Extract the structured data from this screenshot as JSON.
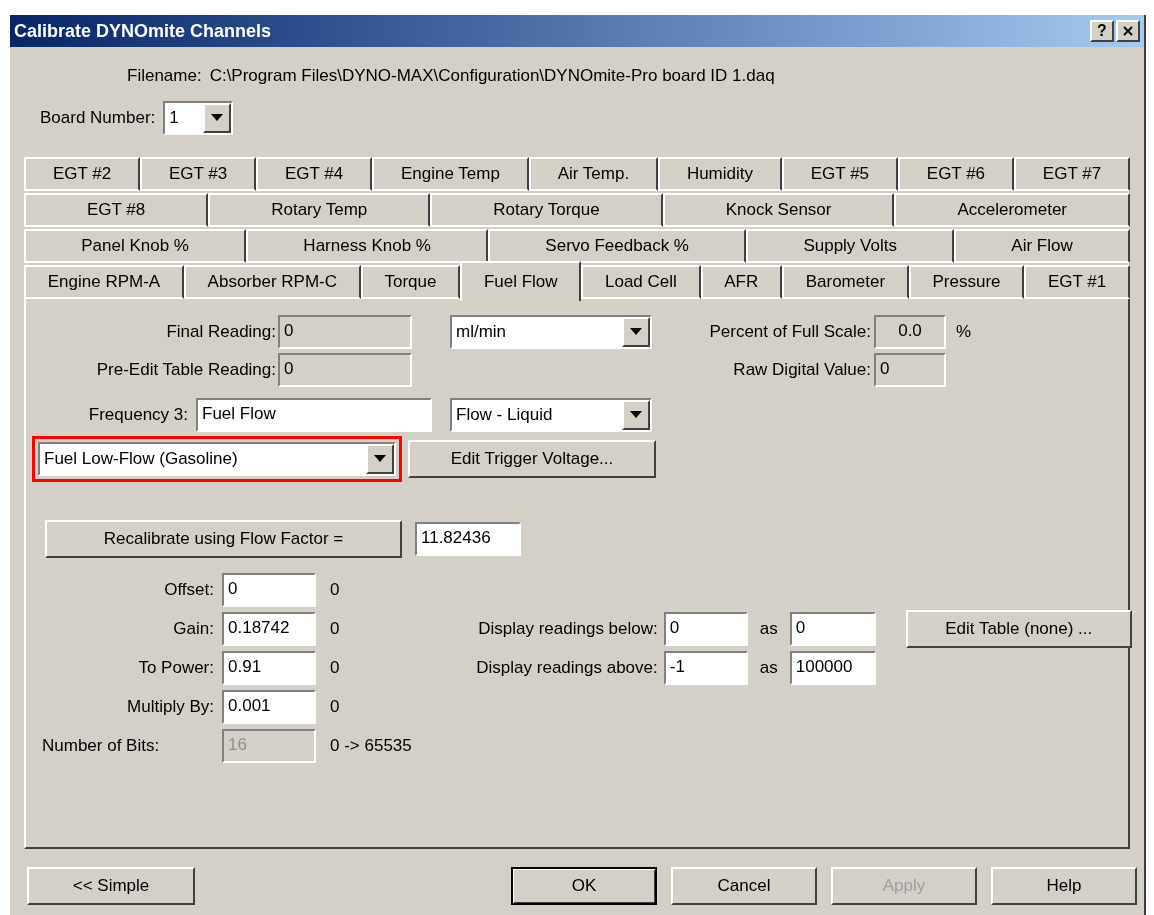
{
  "window": {
    "title": "Calibrate DYNOmite Channels",
    "help_button": "?"
  },
  "filename": {
    "label": "Filename:",
    "value": "C:\\Program Files\\DYNO-MAX\\Configuration\\DYNOmite-Pro board ID 1.daq"
  },
  "board_number": {
    "label": "Board Number:",
    "value": "1"
  },
  "tab_rows": [
    [
      {
        "label": "EGT #2",
        "selected": false
      },
      {
        "label": "EGT #3",
        "selected": false
      },
      {
        "label": "EGT #4",
        "selected": false
      },
      {
        "label": "Engine Temp",
        "selected": false
      },
      {
        "label": "Air Temp.",
        "selected": false
      },
      {
        "label": "Humidity",
        "selected": false
      },
      {
        "label": "EGT #5",
        "selected": false
      },
      {
        "label": "EGT #6",
        "selected": false
      },
      {
        "label": "EGT #7",
        "selected": false
      }
    ],
    [
      {
        "label": "EGT #8",
        "selected": false
      },
      {
        "label": "Rotary Temp",
        "selected": false
      },
      {
        "label": "Rotary Torque",
        "selected": false
      },
      {
        "label": "Knock Sensor",
        "selected": false
      },
      {
        "label": "Accelerometer",
        "selected": false
      }
    ],
    [
      {
        "label": "Panel Knob %",
        "selected": false
      },
      {
        "label": "Harness Knob %",
        "selected": false
      },
      {
        "label": "Servo Feedback %",
        "selected": false
      },
      {
        "label": "Supply Volts",
        "selected": false
      },
      {
        "label": "Air Flow",
        "selected": false
      }
    ],
    [
      {
        "label": "Engine RPM-A",
        "selected": false
      },
      {
        "label": "Absorber RPM-C",
        "selected": false
      },
      {
        "label": "Torque",
        "selected": false
      },
      {
        "label": "Fuel Flow",
        "selected": true
      },
      {
        "label": "Load Cell",
        "selected": false
      },
      {
        "label": "AFR",
        "selected": false
      },
      {
        "label": "Barometer",
        "selected": false
      },
      {
        "label": "Pressure",
        "selected": false
      },
      {
        "label": "EGT #1",
        "selected": false
      }
    ]
  ],
  "readings": {
    "final_reading": {
      "label": "Final Reading:",
      "value": "0",
      "read_only": true
    },
    "unit_select": "ml/min",
    "percent_full_scale": {
      "label": "Percent of Full Scale:",
      "value": "0.0",
      "read_only": true,
      "unit": "%"
    },
    "pre_edit_reading": {
      "label": "Pre-Edit Table Reading:",
      "value": "0",
      "read_only": true
    },
    "raw_digital_value": {
      "label": "Raw Digital Value:",
      "value": "0",
      "read_only": true
    },
    "frequency": {
      "label": "Frequency 3:",
      "value": "Fuel Flow"
    },
    "type_select": "Flow - Liquid",
    "sensor_select": {
      "value": "Fuel Low-Flow (Gasoline)",
      "highlighted": true
    },
    "trigger_button": "Edit Trigger Voltage..."
  },
  "recalibrate": {
    "button": "Recalibrate using Flow Factor =",
    "value": "11.82436"
  },
  "coefficients": [
    {
      "kind": "coefficient",
      "label": "Offset:",
      "value": "0",
      "result": "0",
      "disabled": false
    },
    {
      "kind": "coefficient",
      "label": "Gain:",
      "value": "0.18742",
      "result": "0",
      "disabled": false
    },
    {
      "kind": "coefficient",
      "label": "To Power:",
      "value": "0.91",
      "result": "0",
      "disabled": false
    },
    {
      "kind": "coefficient",
      "label": "Multiply By:",
      "value": "0.001",
      "result": "0",
      "disabled": false
    },
    {
      "kind": "bits",
      "label": "Number of Bits:",
      "value": "16",
      "result": "0 -> 65535",
      "disabled": true
    }
  ],
  "display_limits": [
    {
      "label": "Display readings below:",
      "value": "0",
      "as_label": "as",
      "as_value": "0"
    },
    {
      "label": "Display readings above:",
      "value": "-1",
      "as_label": "as",
      "as_value": "100000"
    }
  ],
  "edit_table_button": "Edit Table (none) ...",
  "footer_buttons": [
    {
      "label": "<< Simple",
      "kind": "normal",
      "disabled": false
    },
    {
      "label": "OK",
      "kind": "default",
      "disabled": false
    },
    {
      "label": "Cancel",
      "kind": "normal",
      "disabled": false
    },
    {
      "label": "Apply",
      "kind": "normal",
      "disabled": true
    },
    {
      "label": "Help",
      "kind": "normal",
      "disabled": false
    }
  ]
}
